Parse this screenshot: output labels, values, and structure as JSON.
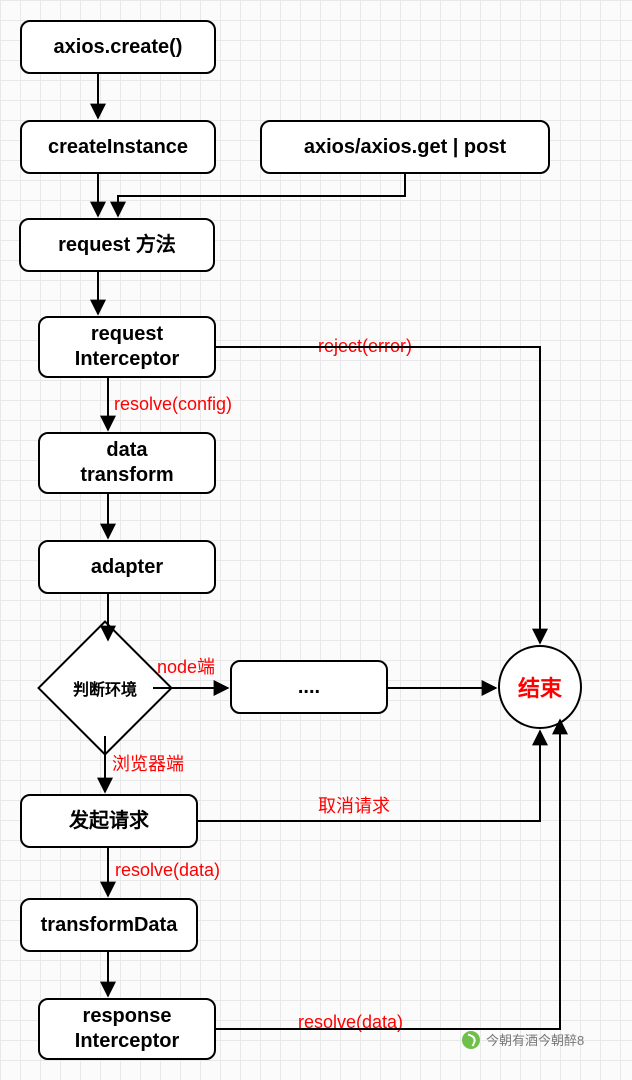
{
  "nodes": {
    "axios_create": "axios.create()",
    "create_instance": "createInstance",
    "axios_get_post": "axios/axios.get | post",
    "request_method": "request 方法",
    "request_interceptor": "request\nInterceptor",
    "data_transform": "data\ntransform",
    "adapter": "adapter",
    "decision": "判断环境",
    "ellipsis": "....",
    "send_request": "发起请求",
    "transform_data": "transformData",
    "response_interceptor": "response\nInterceptor",
    "end": "结束"
  },
  "edges": {
    "reject_error": "reject(error)",
    "resolve_config": "resolve(config)",
    "node_side": "node端",
    "browser_side": "浏览器端",
    "cancel_request": "取消请求",
    "resolve_data_1": "resolve(data)",
    "resolve_data_2": "resolve(data)"
  },
  "watermark": {
    "wechat": "今朝有酒今朝醉8"
  }
}
